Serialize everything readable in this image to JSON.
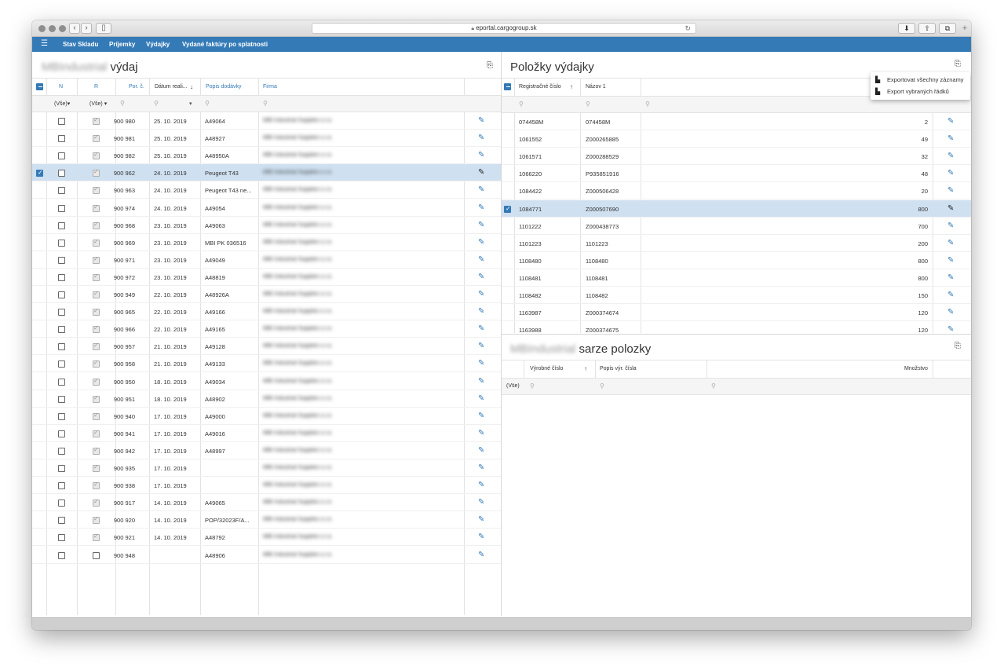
{
  "browser": {
    "url": "eportal.cargogroup.sk",
    "nav_back": "‹",
    "nav_forward": "›",
    "sidebar_icon": "▯",
    "reload_icon": "↻",
    "download_icon": "⬇",
    "share_icon": "⇧",
    "tabs_icon": "⧉",
    "newtab_icon": "+"
  },
  "navbar": {
    "menu_icon": "☰",
    "items": [
      "Stav Skladu",
      "Príjemky",
      "Výdajky",
      "Vydané faktúry po splatnosti"
    ]
  },
  "left_panel": {
    "title_blurred": "MBIndustrial",
    "title": "výdaj",
    "columns": {
      "n": "N",
      "r": "R",
      "por": "Por. č.",
      "datum": "Dátum reali...",
      "popis": "Popis dodávky",
      "firma": "Firma"
    },
    "filters": {
      "n": "(Vše)",
      "r": "(Vše)"
    },
    "firma_blurred": "MBI Industrial Supplies s.r.o.",
    "rows": [
      {
        "por": "900 980",
        "datum": "25. 10. 2019",
        "popis": "A49064",
        "n": false,
        "r": true
      },
      {
        "por": "900 981",
        "datum": "25. 10. 2019",
        "popis": "A48927",
        "n": false,
        "r": true
      },
      {
        "por": "900 982",
        "datum": "25. 10. 2019",
        "popis": "A48950A",
        "n": false,
        "r": true
      },
      {
        "por": "900 962",
        "datum": "24. 10. 2019",
        "popis": "Peugeot T43",
        "n": false,
        "r": true,
        "selected": true
      },
      {
        "por": "900 963",
        "datum": "24. 10. 2019",
        "popis": "Peugeot T43 ne...",
        "n": false,
        "r": true
      },
      {
        "por": "900 974",
        "datum": "24. 10. 2019",
        "popis": "A49054",
        "n": false,
        "r": true
      },
      {
        "por": "900 968",
        "datum": "23. 10. 2019",
        "popis": "A49063",
        "n": false,
        "r": true
      },
      {
        "por": "900 969",
        "datum": "23. 10. 2019",
        "popis": "MBI PK 036516",
        "n": false,
        "r": true
      },
      {
        "por": "900 971",
        "datum": "23. 10. 2019",
        "popis": "A49049",
        "n": false,
        "r": true
      },
      {
        "por": "900 972",
        "datum": "23. 10. 2019",
        "popis": "A48819",
        "n": false,
        "r": true
      },
      {
        "por": "900 949",
        "datum": "22. 10. 2019",
        "popis": "A48926A",
        "n": false,
        "r": true
      },
      {
        "por": "900 965",
        "datum": "22. 10. 2019",
        "popis": "A49166",
        "n": false,
        "r": true
      },
      {
        "por": "900 966",
        "datum": "22. 10. 2019",
        "popis": "A49165",
        "n": false,
        "r": true
      },
      {
        "por": "900 957",
        "datum": "21. 10. 2019",
        "popis": "A49128",
        "n": false,
        "r": true
      },
      {
        "por": "900 958",
        "datum": "21. 10. 2019",
        "popis": "A49133",
        "n": false,
        "r": true
      },
      {
        "por": "900 950",
        "datum": "18. 10. 2019",
        "popis": "A49034",
        "n": false,
        "r": true
      },
      {
        "por": "900 951",
        "datum": "18. 10. 2019",
        "popis": "A48902",
        "n": false,
        "r": true
      },
      {
        "por": "900 940",
        "datum": "17. 10. 2019",
        "popis": "A49000",
        "n": false,
        "r": true
      },
      {
        "por": "900 941",
        "datum": "17. 10. 2019",
        "popis": "A49016",
        "n": false,
        "r": true
      },
      {
        "por": "900 942",
        "datum": "17. 10. 2019",
        "popis": "A48997",
        "n": false,
        "r": true
      },
      {
        "por": "900 935",
        "datum": "17. 10. 2019",
        "popis": "",
        "n": false,
        "r": true
      },
      {
        "por": "900 938",
        "datum": "17. 10. 2019",
        "popis": "",
        "n": false,
        "r": true
      },
      {
        "por": "900 917",
        "datum": "14. 10. 2019",
        "popis": "A49065",
        "n": false,
        "r": true
      },
      {
        "por": "900 920",
        "datum": "14. 10. 2019",
        "popis": "POP/32023F/A...",
        "n": false,
        "r": true
      },
      {
        "por": "900 921",
        "datum": "14. 10. 2019",
        "popis": "A48792",
        "n": false,
        "r": true
      },
      {
        "por": "900 948",
        "datum": "",
        "popis": "A48906",
        "n": false,
        "r": false
      }
    ]
  },
  "right_top": {
    "title": "Položky výdajky",
    "columns": {
      "reg": "Registračné číslo",
      "nazov": "Názov 1"
    },
    "rows": [
      {
        "reg": "074458M",
        "nazov": "074458M",
        "qty": "2"
      },
      {
        "reg": "1061552",
        "nazov": "Z000265885",
        "qty": "49"
      },
      {
        "reg": "1061571",
        "nazov": "Z000288529",
        "qty": "32"
      },
      {
        "reg": "1066220",
        "nazov": "P935851916",
        "qty": "48"
      },
      {
        "reg": "1084422",
        "nazov": "Z000506428",
        "qty": "20"
      },
      {
        "reg": "1084771",
        "nazov": "Z000507690",
        "qty": "800",
        "selected": true
      },
      {
        "reg": "1101222",
        "nazov": "Z000438773",
        "qty": "700"
      },
      {
        "reg": "1101223",
        "nazov": "1101223",
        "qty": "200"
      },
      {
        "reg": "1108480",
        "nazov": "1108480",
        "qty": "800"
      },
      {
        "reg": "1108481",
        "nazov": "1108481",
        "qty": "800"
      },
      {
        "reg": "1108482",
        "nazov": "1108482",
        "qty": "150"
      },
      {
        "reg": "1163987",
        "nazov": "Z000374674",
        "qty": "120"
      },
      {
        "reg": "1163988",
        "nazov": "Z000374675",
        "qty": "120"
      }
    ]
  },
  "export_menu": {
    "items": [
      "Exportovat všechny záznamy",
      "Export vybraných řádků"
    ]
  },
  "right_bottom": {
    "title_blurred": "MBIndustrial",
    "title": "sarze polozky",
    "columns": {
      "vyrobne": "Výrobné číslo",
      "popis": "Popis výr. čísla",
      "mnozstvo": "Množstvo"
    },
    "filter_first": "(Vše)"
  },
  "icons": {
    "search": "⚲",
    "pencil": "✎",
    "sort_up": "↑",
    "sort_down": "↓",
    "dropdown": "▾",
    "export": "⎘"
  }
}
